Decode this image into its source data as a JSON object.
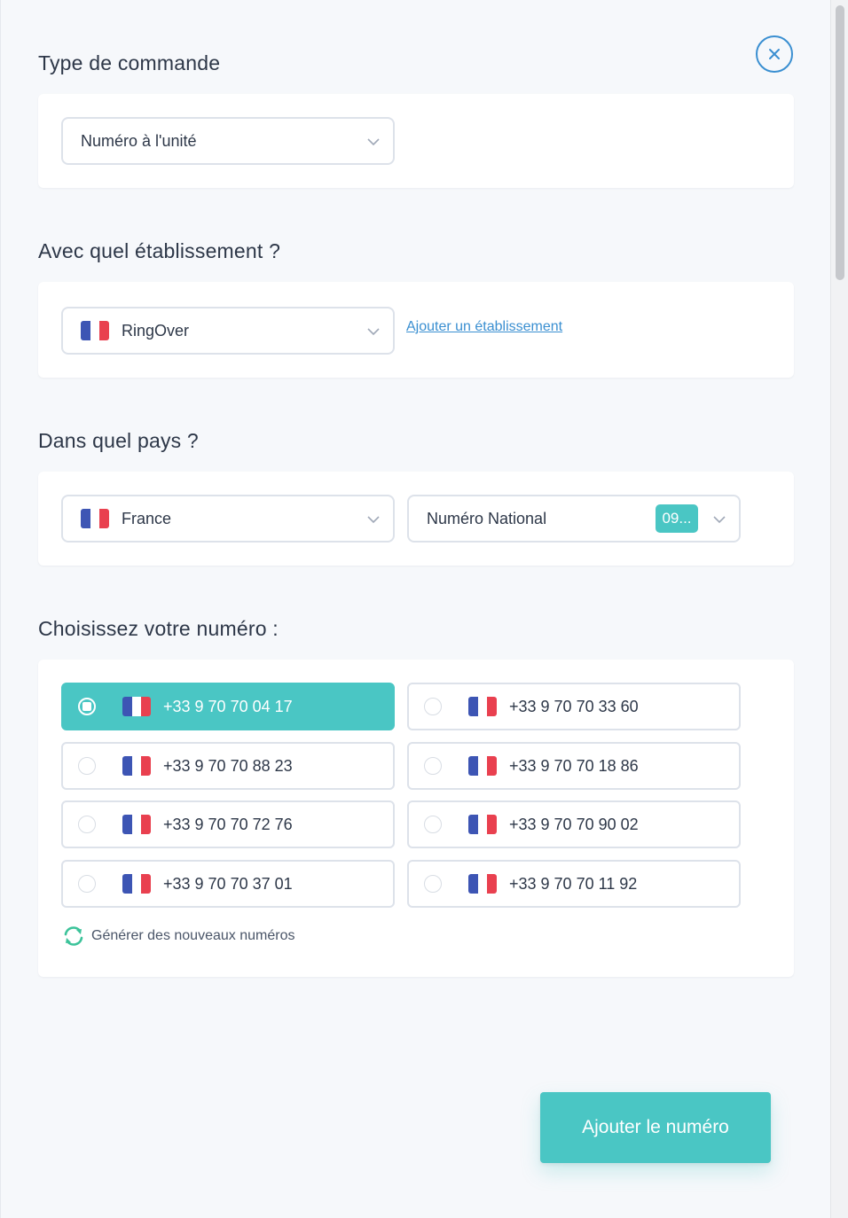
{
  "sections": {
    "order_type": {
      "title": "Type de commande",
      "select_value": "Numéro à l'unité"
    },
    "establishment": {
      "title": "Avec quel établissement ?",
      "select_value": "RingOver",
      "add_link": "Ajouter un établissement"
    },
    "country": {
      "title": "Dans quel pays ?",
      "country_value": "France",
      "number_type_value": "Numéro National",
      "prefix_badge": "09..."
    },
    "choose_number": {
      "title": "Choisissez votre numéro :",
      "numbers": [
        {
          "value": "+33 9 70 70 04 17",
          "selected": true
        },
        {
          "value": "+33 9 70 70 33 60",
          "selected": false
        },
        {
          "value": "+33 9 70 70 88 23",
          "selected": false
        },
        {
          "value": "+33 9 70 70 18 86",
          "selected": false
        },
        {
          "value": "+33 9 70 70 72 76",
          "selected": false
        },
        {
          "value": "+33 9 70 70 90 02",
          "selected": false
        },
        {
          "value": "+33 9 70 70 37 01",
          "selected": false
        },
        {
          "value": "+33 9 70 70 11 92",
          "selected": false
        }
      ],
      "generate_label": "Générer des nouveaux numéros"
    }
  },
  "actions": {
    "submit_label": "Ajouter le numéro"
  },
  "icons": {
    "close": "close-icon",
    "chevron": "chevron-down-icon",
    "flag": "france-flag-icon",
    "refresh": "refresh-icon"
  },
  "colors": {
    "accent": "#4ac6c4",
    "link": "#3a8fd1",
    "text": "#2d3748"
  }
}
